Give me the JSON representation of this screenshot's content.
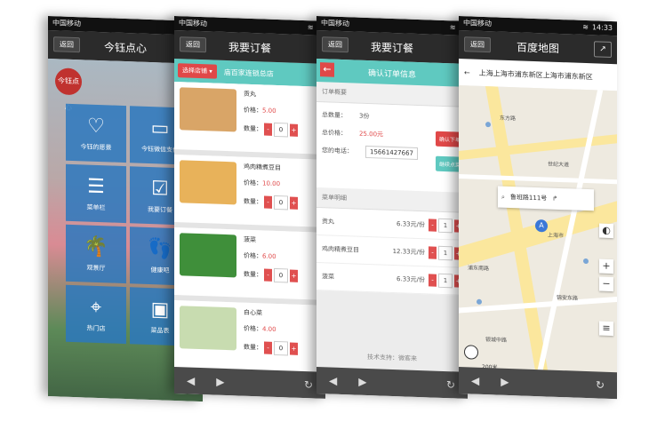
{
  "common": {
    "carrier": "中国移动",
    "back_label": "返回",
    "time": "14:33"
  },
  "phone1": {
    "title": "今钰点心",
    "logo_text": "今钰点心",
    "tiles": [
      {
        "icon": "heart-icon",
        "glyph": "♡",
        "label": "今钰的愿景"
      },
      {
        "icon": "card-icon",
        "glyph": "▭",
        "label": "今钰微信支付"
      },
      {
        "icon": "list-icon",
        "glyph": "☰",
        "label": "菜单栏"
      },
      {
        "icon": "checkbox-icon",
        "glyph": "☑",
        "label": "我要订餐"
      },
      {
        "icon": "palm-icon",
        "glyph": "🌴",
        "label": "观景厅"
      },
      {
        "icon": "footprints-icon",
        "glyph": "👣",
        "label": "健康吧"
      },
      {
        "icon": "location-icon",
        "glyph": "⌖",
        "label": "热门店"
      },
      {
        "icon": "box-icon",
        "glyph": "▣",
        "label": "菜品表"
      }
    ]
  },
  "phone2": {
    "title": "我要订餐",
    "shop_select": "选择店铺",
    "shop_name": "庙百家连锁总店",
    "price_label": "价格：",
    "qty_label": "数量：",
    "dishes": [
      {
        "name": "贡丸",
        "price": "5.00",
        "qty": "0",
        "color": "#d9a567"
      },
      {
        "name": "鸡肉精煮豆目",
        "price": "10.00",
        "qty": "0",
        "color": "#e8b25a"
      },
      {
        "name": "菠菜",
        "price": "6.00",
        "qty": "0",
        "color": "#3f8f3a"
      },
      {
        "name": "白心菜",
        "price": "4.00",
        "qty": "0",
        "color": "#c8dcb0"
      }
    ]
  },
  "phone3": {
    "title": "我要订餐",
    "header": "确认订单信息",
    "summary_title": "订单概要",
    "total_qty_label": "总数量：",
    "total_qty": "3份",
    "total_price_label": "总价格：",
    "total_price": "25.00元",
    "phone_label": "您的电话：",
    "phone_value": "15661427667",
    "btn_confirm": "确认下单",
    "btn_modify": "继续点菜",
    "detail_title": "菜单明细",
    "items": [
      {
        "name": "贡丸",
        "price": "6.33元/份",
        "qty": "1"
      },
      {
        "name": "鸡肉精煮豆目",
        "price": "12.33元/份",
        "qty": "1"
      },
      {
        "name": "菠菜",
        "price": "6.33元/份",
        "qty": "1"
      }
    ],
    "support": "技术支持：微客来"
  },
  "phone4": {
    "title": "百度地图",
    "address": "上海上海市浦东新区上海市浦东新区",
    "search_text": "鲁班路111号",
    "scale_text": "200米",
    "labels": [
      "世纪大道",
      "东方路",
      "浦东南路",
      "锦安东路",
      "上海市",
      "银城中路"
    ]
  }
}
